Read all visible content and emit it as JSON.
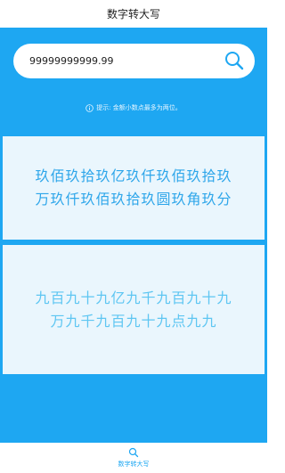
{
  "app": {
    "title": "数字转大写"
  },
  "search": {
    "value": "99999999999.99",
    "icon": "search-icon"
  },
  "hint": {
    "text": "提示: 金额小数点最多为两位。",
    "icon": "info-icon"
  },
  "result_upper": {
    "lines": [
      "玖佰玖拾玖亿玖仟玖佰玖拾玖",
      "万玖仟玖佰玖拾玖圆玖角玖分"
    ]
  },
  "result_lower": {
    "lines": [
      "九百九十九亿九千九百九十九",
      "万九千九百九十九点九九"
    ]
  },
  "tabbar": {
    "items": [
      {
        "label": "数字转大写",
        "icon": "search-icon"
      }
    ]
  },
  "colors": {
    "accent": "#1ea7f2",
    "panel": "#eaf6fd",
    "upper_text": "#2ea6ea",
    "lower_text": "#5ec6f2"
  }
}
